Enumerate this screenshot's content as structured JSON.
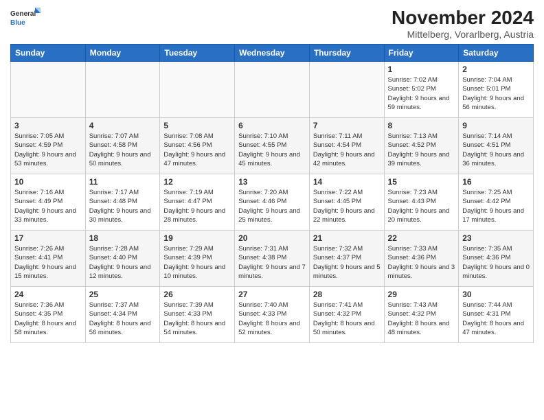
{
  "logo": {
    "line1": "General",
    "line2": "Blue"
  },
  "title": "November 2024",
  "subtitle": "Mittelberg, Vorarlberg, Austria",
  "headers": [
    "Sunday",
    "Monday",
    "Tuesday",
    "Wednesday",
    "Thursday",
    "Friday",
    "Saturday"
  ],
  "weeks": [
    [
      {
        "day": "",
        "info": ""
      },
      {
        "day": "",
        "info": ""
      },
      {
        "day": "",
        "info": ""
      },
      {
        "day": "",
        "info": ""
      },
      {
        "day": "",
        "info": ""
      },
      {
        "day": "1",
        "info": "Sunrise: 7:02 AM\nSunset: 5:02 PM\nDaylight: 9 hours and 59 minutes."
      },
      {
        "day": "2",
        "info": "Sunrise: 7:04 AM\nSunset: 5:01 PM\nDaylight: 9 hours and 56 minutes."
      }
    ],
    [
      {
        "day": "3",
        "info": "Sunrise: 7:05 AM\nSunset: 4:59 PM\nDaylight: 9 hours and 53 minutes."
      },
      {
        "day": "4",
        "info": "Sunrise: 7:07 AM\nSunset: 4:58 PM\nDaylight: 9 hours and 50 minutes."
      },
      {
        "day": "5",
        "info": "Sunrise: 7:08 AM\nSunset: 4:56 PM\nDaylight: 9 hours and 47 minutes."
      },
      {
        "day": "6",
        "info": "Sunrise: 7:10 AM\nSunset: 4:55 PM\nDaylight: 9 hours and 45 minutes."
      },
      {
        "day": "7",
        "info": "Sunrise: 7:11 AM\nSunset: 4:54 PM\nDaylight: 9 hours and 42 minutes."
      },
      {
        "day": "8",
        "info": "Sunrise: 7:13 AM\nSunset: 4:52 PM\nDaylight: 9 hours and 39 minutes."
      },
      {
        "day": "9",
        "info": "Sunrise: 7:14 AM\nSunset: 4:51 PM\nDaylight: 9 hours and 36 minutes."
      }
    ],
    [
      {
        "day": "10",
        "info": "Sunrise: 7:16 AM\nSunset: 4:49 PM\nDaylight: 9 hours and 33 minutes."
      },
      {
        "day": "11",
        "info": "Sunrise: 7:17 AM\nSunset: 4:48 PM\nDaylight: 9 hours and 30 minutes."
      },
      {
        "day": "12",
        "info": "Sunrise: 7:19 AM\nSunset: 4:47 PM\nDaylight: 9 hours and 28 minutes."
      },
      {
        "day": "13",
        "info": "Sunrise: 7:20 AM\nSunset: 4:46 PM\nDaylight: 9 hours and 25 minutes."
      },
      {
        "day": "14",
        "info": "Sunrise: 7:22 AM\nSunset: 4:45 PM\nDaylight: 9 hours and 22 minutes."
      },
      {
        "day": "15",
        "info": "Sunrise: 7:23 AM\nSunset: 4:43 PM\nDaylight: 9 hours and 20 minutes."
      },
      {
        "day": "16",
        "info": "Sunrise: 7:25 AM\nSunset: 4:42 PM\nDaylight: 9 hours and 17 minutes."
      }
    ],
    [
      {
        "day": "17",
        "info": "Sunrise: 7:26 AM\nSunset: 4:41 PM\nDaylight: 9 hours and 15 minutes."
      },
      {
        "day": "18",
        "info": "Sunrise: 7:28 AM\nSunset: 4:40 PM\nDaylight: 9 hours and 12 minutes."
      },
      {
        "day": "19",
        "info": "Sunrise: 7:29 AM\nSunset: 4:39 PM\nDaylight: 9 hours and 10 minutes."
      },
      {
        "day": "20",
        "info": "Sunrise: 7:31 AM\nSunset: 4:38 PM\nDaylight: 9 hours and 7 minutes."
      },
      {
        "day": "21",
        "info": "Sunrise: 7:32 AM\nSunset: 4:37 PM\nDaylight: 9 hours and 5 minutes."
      },
      {
        "day": "22",
        "info": "Sunrise: 7:33 AM\nSunset: 4:36 PM\nDaylight: 9 hours and 3 minutes."
      },
      {
        "day": "23",
        "info": "Sunrise: 7:35 AM\nSunset: 4:36 PM\nDaylight: 9 hours and 0 minutes."
      }
    ],
    [
      {
        "day": "24",
        "info": "Sunrise: 7:36 AM\nSunset: 4:35 PM\nDaylight: 8 hours and 58 minutes."
      },
      {
        "day": "25",
        "info": "Sunrise: 7:37 AM\nSunset: 4:34 PM\nDaylight: 8 hours and 56 minutes."
      },
      {
        "day": "26",
        "info": "Sunrise: 7:39 AM\nSunset: 4:33 PM\nDaylight: 8 hours and 54 minutes."
      },
      {
        "day": "27",
        "info": "Sunrise: 7:40 AM\nSunset: 4:33 PM\nDaylight: 8 hours and 52 minutes."
      },
      {
        "day": "28",
        "info": "Sunrise: 7:41 AM\nSunset: 4:32 PM\nDaylight: 8 hours and 50 minutes."
      },
      {
        "day": "29",
        "info": "Sunrise: 7:43 AM\nSunset: 4:32 PM\nDaylight: 8 hours and 48 minutes."
      },
      {
        "day": "30",
        "info": "Sunrise: 7:44 AM\nSunset: 4:31 PM\nDaylight: 8 hours and 47 minutes."
      }
    ]
  ]
}
